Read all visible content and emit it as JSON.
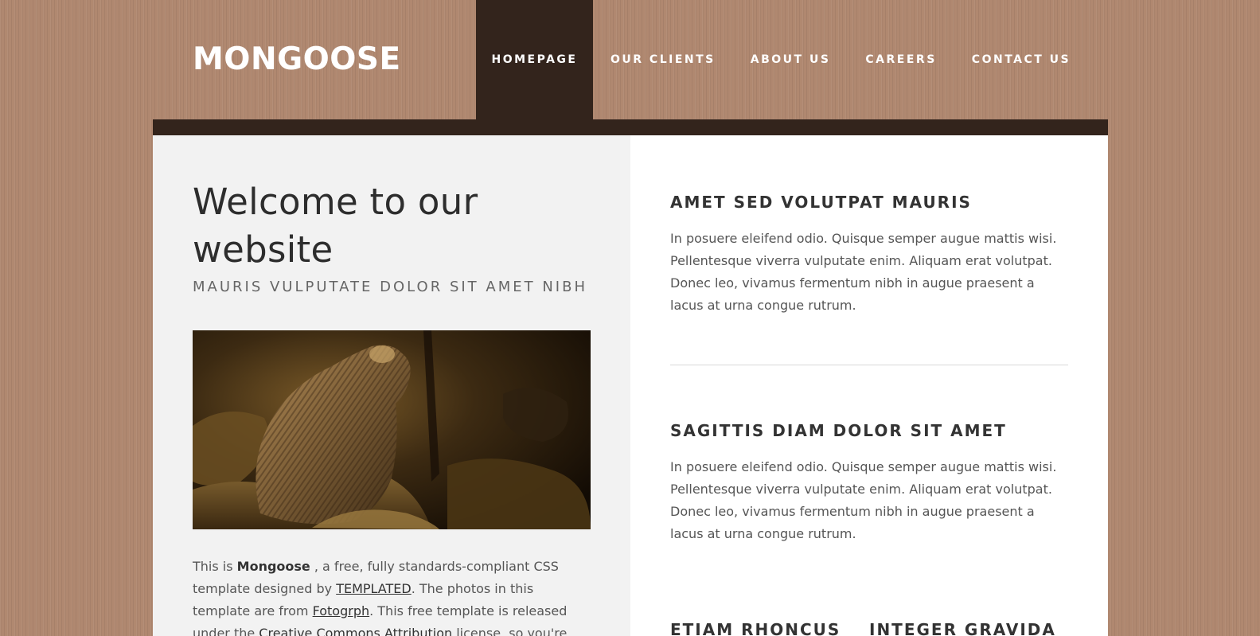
{
  "header": {
    "logo": "MONGOOSE",
    "menu": [
      {
        "label": "HOMEPAGE",
        "active": true
      },
      {
        "label": "OUR CLIENTS",
        "active": false
      },
      {
        "label": "ABOUT US",
        "active": false
      },
      {
        "label": "CAREERS",
        "active": false
      },
      {
        "label": "CONTACT US",
        "active": false
      }
    ]
  },
  "welcome": {
    "title": "Welcome to our website",
    "subtitle": "MAURIS VULPUTATE DOLOR SIT AMET NIBH",
    "image_icon": "mongoose-photo",
    "intro": {
      "part1": "This is ",
      "brand": "Mongoose",
      "part2": " , a free, fully standards-compliant CSS template designed by ",
      "link1": "TEMPLATED",
      "part3": ". The photos in this template are from ",
      "link2": "Fotogrph",
      "part4": ". This free template is released under the ",
      "link3": "Creative Commons Attribution",
      "part5": " license, so you're pretty much free to do"
    }
  },
  "sidebar": {
    "sections": [
      {
        "heading": "AMET SED VOLUTPAT MAURIS",
        "text": "In posuere eleifend odio. Quisque semper augue mattis wisi. Pellentesque viverra vulputate enim. Aliquam erat volutpat. Donec leo, vivamus fermentum nibh in augue praesent a lacus at urna congue rutrum."
      },
      {
        "heading": "SAGITTIS DIAM DOLOR SIT AMET",
        "text": "In posuere eleifend odio. Quisque semper augue mattis wisi. Pellentesque viverra vulputate enim. Aliquam erat volutpat. Donec leo, vivamus fermentum nibh in augue praesent a lacus at urna congue rutrum."
      }
    ],
    "bottom_headings": [
      "ETIAM RHONCUS",
      "INTEGER GRAVIDA"
    ]
  },
  "colors": {
    "background": "#b08870",
    "dark_brown": "#33241c",
    "left_panel": "#f2f2f2",
    "right_panel": "#ffffff"
  }
}
